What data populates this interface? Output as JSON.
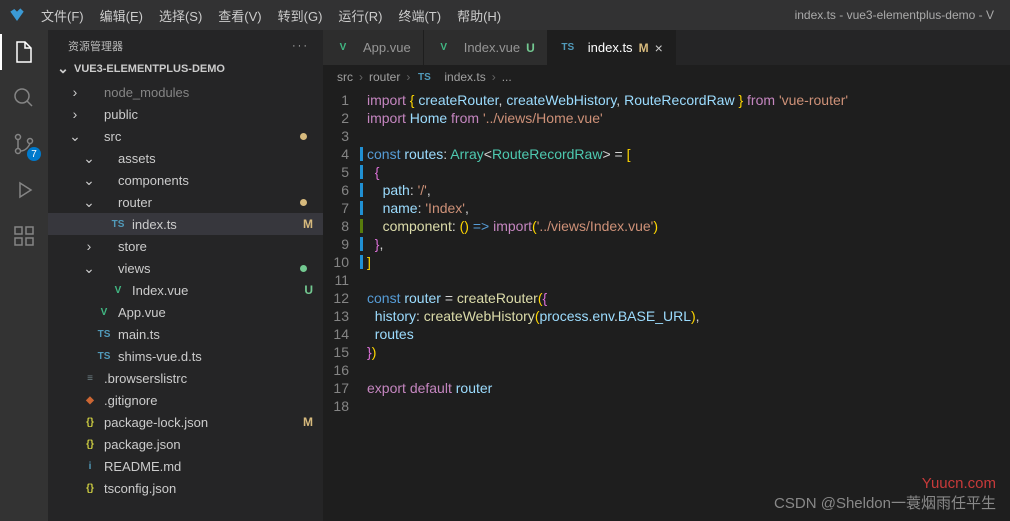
{
  "menubar": [
    "文件(F)",
    "编辑(E)",
    "选择(S)",
    "查看(V)",
    "转到(G)",
    "运行(R)",
    "终端(T)",
    "帮助(H)"
  ],
  "window_title": "index.ts - vue3-elementplus-demo - V",
  "activity_badge": "7",
  "sidebar": {
    "title": "资源管理器",
    "section": "VUE3-ELEMENTPLUS-DEMO",
    "tree": [
      {
        "indent": 1,
        "chev": "›",
        "icon": "folder",
        "label": "node_modules",
        "dim": true
      },
      {
        "indent": 1,
        "chev": "›",
        "icon": "folder",
        "label": "public"
      },
      {
        "indent": 1,
        "chev": "⌄",
        "icon": "folder",
        "label": "src",
        "dot": "modified"
      },
      {
        "indent": 2,
        "chev": "⌄",
        "icon": "folder",
        "label": "assets"
      },
      {
        "indent": 2,
        "chev": "⌄",
        "icon": "folder",
        "label": "components"
      },
      {
        "indent": 2,
        "chev": "⌄",
        "icon": "folder",
        "label": "router",
        "dot": "modified"
      },
      {
        "indent": 3,
        "icon": "ts",
        "label": "index.ts",
        "status": "M",
        "selected": true,
        "iconText": "TS"
      },
      {
        "indent": 2,
        "chev": "›",
        "icon": "folder",
        "label": "store"
      },
      {
        "indent": 2,
        "chev": "⌄",
        "icon": "folder",
        "label": "views",
        "dot": "untracked"
      },
      {
        "indent": 3,
        "icon": "vue",
        "label": "Index.vue",
        "status": "U",
        "iconText": "V"
      },
      {
        "indent": 2,
        "icon": "vue",
        "label": "App.vue",
        "iconText": "V"
      },
      {
        "indent": 2,
        "icon": "ts",
        "label": "main.ts",
        "iconText": "TS"
      },
      {
        "indent": 2,
        "icon": "ts",
        "label": "shims-vue.d.ts",
        "iconText": "TS"
      },
      {
        "indent": 1,
        "icon": "txt",
        "label": ".browserslistrc",
        "iconText": "≡"
      },
      {
        "indent": 1,
        "icon": "git",
        "label": ".gitignore",
        "iconText": "◆"
      },
      {
        "indent": 1,
        "icon": "json",
        "label": "package-lock.json",
        "status": "M",
        "iconText": "{}"
      },
      {
        "indent": 1,
        "icon": "json",
        "label": "package.json",
        "iconText": "{}"
      },
      {
        "indent": 1,
        "icon": "md",
        "label": "README.md",
        "iconText": "i"
      },
      {
        "indent": 1,
        "icon": "json",
        "label": "tsconfig.json",
        "iconText": "{}"
      }
    ]
  },
  "tabs": [
    {
      "icon": "vue",
      "label": "App.vue",
      "iconText": "V"
    },
    {
      "icon": "vue",
      "label": "Index.vue",
      "status": "U",
      "statusClass": "U",
      "iconText": "V"
    },
    {
      "icon": "ts",
      "label": "index.ts",
      "status": "M",
      "statusClass": "M",
      "active": true,
      "close": true,
      "iconText": "TS"
    }
  ],
  "breadcrumb": [
    "src",
    "router",
    "index.ts",
    "..."
  ],
  "breadcrumb_icons": [
    "",
    "",
    "TS",
    ""
  ],
  "code": {
    "lines": [
      {
        "n": 1,
        "html": "<span class='tok-kw'>import</span> <span class='tok-brace'>{</span> <span class='tok-id'>createRouter</span><span class='tok-punc'>,</span> <span class='tok-id'>createWebHistory</span><span class='tok-punc'>,</span> <span class='tok-id'>RouteRecordRaw</span> <span class='tok-brace'>}</span> <span class='tok-kw'>from</span> <span class='tok-str'>'vue-router'</span>"
      },
      {
        "n": 2,
        "html": "<span class='tok-kw'>import</span> <span class='tok-id'>Home</span> <span class='tok-kw'>from</span> <span class='tok-str'>'../views/Home.vue'</span>"
      },
      {
        "n": 3,
        "html": ""
      },
      {
        "n": 4,
        "deco": "m",
        "html": "<span class='tok-var'>const</span> <span class='tok-id'>routes</span><span class='tok-punc'>:</span> <span class='tok-type'>Array</span><span class='tok-punc'>&lt;</span><span class='tok-type'>RouteRecordRaw</span><span class='tok-punc'>&gt;</span> <span class='tok-punc'>=</span> <span class='tok-brace'>[</span>"
      },
      {
        "n": 5,
        "deco": "m",
        "html": "  <span class='tok-brace2'>{</span>"
      },
      {
        "n": 6,
        "deco": "m",
        "html": "    <span class='tok-id'>path</span><span class='tok-punc'>:</span> <span class='tok-str'>'/'</span><span class='tok-punc'>,</span>"
      },
      {
        "n": 7,
        "deco": "m",
        "html": "    <span class='tok-id'>name</span><span class='tok-punc'>:</span> <span class='tok-str'>'Index'</span><span class='tok-punc'>,</span>"
      },
      {
        "n": 8,
        "deco": "a",
        "html": "    <span class='tok-fn'>component</span><span class='tok-punc'>:</span> <span class='tok-brace'>(</span><span class='tok-brace'>)</span> <span class='tok-var'>=&gt;</span> <span class='tok-kw'>import</span><span class='tok-brace'>(</span><span class='tok-str'>'../views/Index.vue'</span><span class='tok-brace'>)</span>"
      },
      {
        "n": 9,
        "deco": "m",
        "html": "  <span class='tok-brace2'>}</span><span class='tok-punc'>,</span>"
      },
      {
        "n": 10,
        "deco": "m",
        "html": "<span class='tok-brace'>]</span>"
      },
      {
        "n": 11,
        "html": ""
      },
      {
        "n": 12,
        "html": "<span class='tok-var'>const</span> <span class='tok-id'>router</span> <span class='tok-punc'>=</span> <span class='tok-fn'>createRouter</span><span class='tok-brace'>(</span><span class='tok-brace2'>{</span>"
      },
      {
        "n": 13,
        "html": "  <span class='tok-id'>history</span><span class='tok-punc'>:</span> <span class='tok-fn'>createWebHistory</span><span class='tok-brace'>(</span><span class='tok-id'>process</span><span class='tok-punc'>.</span><span class='tok-id'>env</span><span class='tok-punc'>.</span><span class='tok-id'>BASE_URL</span><span class='tok-brace'>)</span><span class='tok-punc'>,</span>"
      },
      {
        "n": 14,
        "html": "  <span class='tok-id'>routes</span>"
      },
      {
        "n": 15,
        "html": "<span class='tok-brace2'>}</span><span class='tok-brace'>)</span>"
      },
      {
        "n": 16,
        "html": ""
      },
      {
        "n": 17,
        "html": "<span class='tok-kw'>export</span> <span class='tok-kw'>default</span> <span class='tok-id'>router</span>"
      },
      {
        "n": 18,
        "html": ""
      }
    ]
  },
  "watermark": {
    "top": "Yuucn.com",
    "bottom": "CSDN @Sheldon一蓑烟雨任平生"
  }
}
